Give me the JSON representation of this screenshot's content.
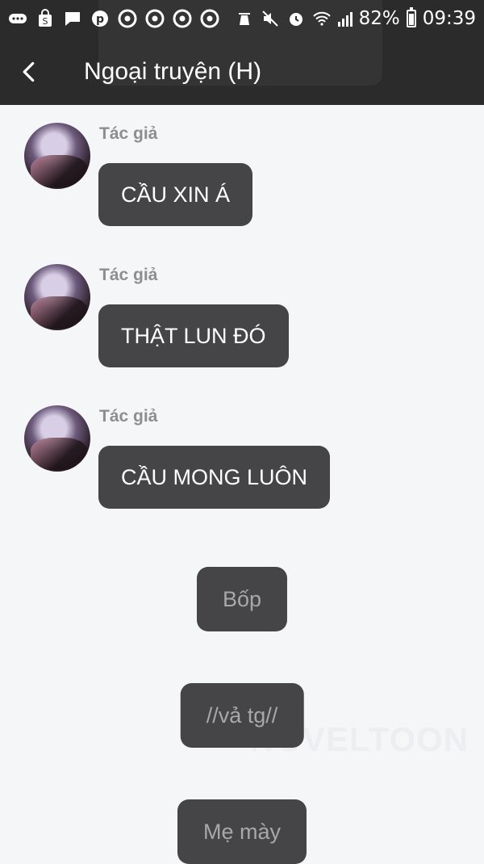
{
  "statusbar": {
    "icons": [
      "more-icon",
      "shopping-bag-icon",
      "message-icon",
      "pinterest-icon",
      "chrome-icon",
      "chrome-icon",
      "chrome-icon",
      "chrome-icon",
      "recycle-icon",
      "mute-icon",
      "alarm-icon",
      "wifi-icon",
      "signal-icon"
    ],
    "battery": "82%",
    "time": "09:39"
  },
  "header": {
    "title": "Ngoại truyện (H)",
    "back_icon": "chevron-left-icon"
  },
  "messages": [
    {
      "author": "Tác giả",
      "text": "CẦU XIN Á"
    },
    {
      "author": "Tác giả",
      "text": "THẬT LUN ĐÓ"
    },
    {
      "author": "Tác giả",
      "text": "CẦU MONG LUÔN"
    }
  ],
  "narration": [
    {
      "text": "Bốp"
    },
    {
      "text": "//vả tg//"
    },
    {
      "text": "Mẹ mày"
    }
  ],
  "watermark": "NOVELTOON",
  "colors": {
    "header_bg": "#2b2b2c",
    "page_bg": "#f5f6f8",
    "bubble_bg": "#454547",
    "narration_text": "#a8a8ab",
    "author_text": "#8e8e92"
  }
}
